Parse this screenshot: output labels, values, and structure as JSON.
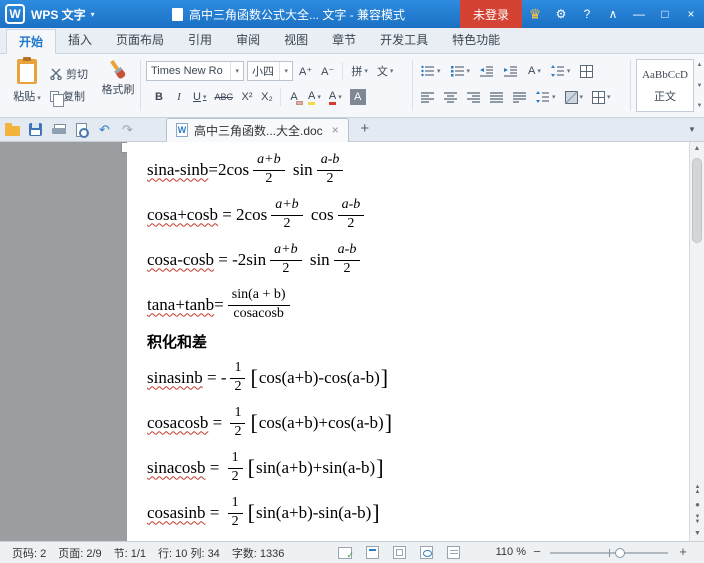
{
  "titlebar": {
    "logo": "W",
    "app_name": "WPS 文字",
    "doc_title": "高中三角函数公式大全... 文字 - 兼容模式",
    "login_label": "未登录",
    "icons": {
      "crown": "♛",
      "gear": "⚙",
      "help": "?",
      "collapse": "∧",
      "minimize": "—",
      "maximize": "□",
      "close": "×"
    }
  },
  "ribbon_tabs": [
    {
      "id": "home",
      "label": "开始",
      "active": true
    },
    {
      "id": "insert",
      "label": "插入"
    },
    {
      "id": "page-layout",
      "label": "页面布局"
    },
    {
      "id": "references",
      "label": "引用"
    },
    {
      "id": "review",
      "label": "审阅"
    },
    {
      "id": "view",
      "label": "视图"
    },
    {
      "id": "sections",
      "label": "章节"
    },
    {
      "id": "developer",
      "label": "开发工具"
    },
    {
      "id": "special-features",
      "label": "特色功能"
    }
  ],
  "ribbon": {
    "paste_label": "粘贴",
    "cut_label": "剪切",
    "copy_label": "复制",
    "format_painter_label": "格式刷",
    "font_name": "Times New Ro",
    "font_size": "小四",
    "grow_font": "A⁺",
    "shrink_font": "A⁻",
    "pinyin_label": "拼",
    "phonetic_label": "文",
    "bold": "B",
    "italic": "I",
    "underline": "U",
    "strikethrough": "ABC",
    "superscript": "X²",
    "subscript": "X₂",
    "clear_format": "A",
    "highlight": "A",
    "font_color": "A",
    "char_shading": "A",
    "char_scale": "A",
    "style_preview": "AaBbCcD",
    "style_name": "正文"
  },
  "toolbar": {
    "doc_tab_title": "高中三角函数...大全.doc",
    "tab_close": "×",
    "new_tab": "+",
    "undo": "↶",
    "redo": "↷",
    "doc_w": "W",
    "tab_list": "▼"
  },
  "document": {
    "lines": [
      {
        "kind": "formula",
        "parts": [
          {
            "t": "text",
            "v": "sina-sinb",
            "wavy": true
          },
          {
            "t": "text",
            "v": "=2cos"
          },
          {
            "t": "frac",
            "num": "a+b",
            "den": "2",
            "italic": true
          },
          {
            "t": "text",
            "v": " sin"
          },
          {
            "t": "frac",
            "num": "a-b",
            "den": "2",
            "italic": true
          }
        ]
      },
      {
        "kind": "formula",
        "parts": [
          {
            "t": "text",
            "v": "cosa+cosb",
            "wavy": true
          },
          {
            "t": "text",
            "v": " = 2cos"
          },
          {
            "t": "frac",
            "num": "a+b",
            "den": "2",
            "italic": true
          },
          {
            "t": "text",
            "v": " cos"
          },
          {
            "t": "frac",
            "num": "a-b",
            "den": "2",
            "italic": true
          }
        ]
      },
      {
        "kind": "formula",
        "parts": [
          {
            "t": "text",
            "v": "cosa-cosb",
            "wavy": true
          },
          {
            "t": "text",
            "v": " = -2sin"
          },
          {
            "t": "frac",
            "num": "a+b",
            "den": "2",
            "italic": true
          },
          {
            "t": "text",
            "v": " sin"
          },
          {
            "t": "frac",
            "num": "a-b",
            "den": "2",
            "italic": true
          }
        ]
      },
      {
        "kind": "formula",
        "parts": [
          {
            "t": "text",
            "v": "tana+tanb",
            "wavy": true
          },
          {
            "t": "text",
            "v": "="
          },
          {
            "t": "frac",
            "num": "sin(a + b)",
            "den": "cosacosb",
            "italic": false
          }
        ]
      },
      {
        "kind": "heading",
        "text": "积化和差"
      },
      {
        "kind": "formula",
        "parts": [
          {
            "t": "text",
            "v": "sinasinb",
            "wavy": true
          },
          {
            "t": "text",
            "v": " = -"
          },
          {
            "t": "frac",
            "num": "1",
            "den": "2",
            "italic": false
          },
          {
            "t": "bracket",
            "v": "["
          },
          {
            "t": "text",
            "v": "cos(a+b)-cos(a-b)"
          },
          {
            "t": "bracket",
            "v": "]"
          }
        ]
      },
      {
        "kind": "formula",
        "parts": [
          {
            "t": "text",
            "v": "cosacosb",
            "wavy": true
          },
          {
            "t": "text",
            "v": " = "
          },
          {
            "t": "frac",
            "num": "1",
            "den": "2",
            "italic": false
          },
          {
            "t": "bracket",
            "v": "["
          },
          {
            "t": "text",
            "v": "cos(a+b)+cos(a-b)"
          },
          {
            "t": "bracket",
            "v": "]"
          }
        ]
      },
      {
        "kind": "formula",
        "parts": [
          {
            "t": "text",
            "v": "sinacosb",
            "wavy": true
          },
          {
            "t": "text",
            "v": " = "
          },
          {
            "t": "frac",
            "num": "1",
            "den": "2",
            "italic": false
          },
          {
            "t": "bracket",
            "v": "["
          },
          {
            "t": "text",
            "v": "sin(a+b)+sin(a-b)"
          },
          {
            "t": "bracket",
            "v": "]"
          }
        ]
      },
      {
        "kind": "formula",
        "parts": [
          {
            "t": "text",
            "v": "cosasinb",
            "wavy": true
          },
          {
            "t": "text",
            "v": " = "
          },
          {
            "t": "frac",
            "num": "1",
            "den": "2",
            "italic": false
          },
          {
            "t": "bracket",
            "v": "["
          },
          {
            "t": "text",
            "v": "sin(a+b)-sin(a-b)"
          },
          {
            "t": "bracket",
            "v": "]"
          }
        ]
      }
    ]
  },
  "statusbar": {
    "page": "页码: 2",
    "pages": "页面: 2/9",
    "section": "节: 1/1",
    "line_col": "行: 10 列: 34",
    "words": "字数: 1336",
    "zoom": "110 %"
  },
  "colors": {
    "titlebar_blue": "#1d7ad0",
    "login_red": "#d44233",
    "accent_blue": "#2f7cc3",
    "doc_bg_gray": "#9b9da0",
    "spellcheck_red": "#c0392b"
  }
}
